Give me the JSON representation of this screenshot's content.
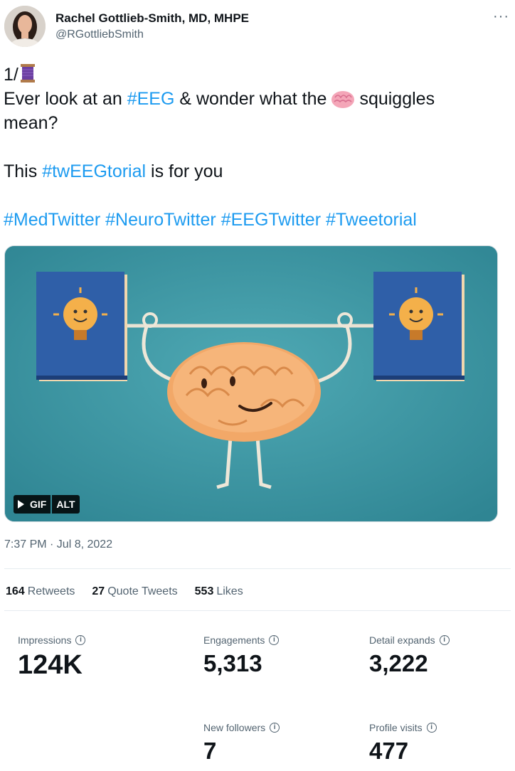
{
  "author": {
    "name": "Rachel Gottlieb-Smith, MD, MHPE",
    "handle": "@RGottliebSmith",
    "more": "···"
  },
  "tweet": {
    "prefix": "1/",
    "l2_a": "Ever look at an ",
    "l2_tag": "#EEG",
    "l2_b": " & wonder what the",
    "l2_c": "squiggles",
    "l3": "mean?",
    "l4_a": "This ",
    "l4_tag": "#twEEGtorial",
    "l4_b": " is for you",
    "tags": [
      "#MedTwitter",
      "#NeuroTwitter",
      "#EEGTwitter",
      "#Tweetorial"
    ]
  },
  "media": {
    "gif_label": "GIF",
    "alt_label": "ALT",
    "colors": {
      "background": "#3f98a4",
      "book": "#2f5fa8",
      "brain": "#f2a868"
    }
  },
  "timestamp": "7:37 PM · Jul 8, 2022",
  "stats": [
    {
      "value": "164",
      "label": "Retweets"
    },
    {
      "value": "27",
      "label": "Quote Tweets"
    },
    {
      "value": "553",
      "label": "Likes"
    }
  ],
  "analytics": {
    "impressions": {
      "label": "Impressions",
      "value": "124K"
    },
    "engagements": {
      "label": "Engagements",
      "value": "5,313"
    },
    "detail_expands": {
      "label": "Detail expands",
      "value": "3,222"
    },
    "new_followers": {
      "label": "New followers",
      "value": "7"
    },
    "profile_visits": {
      "label": "Profile visits",
      "value": "477"
    },
    "info_icon": "i"
  }
}
